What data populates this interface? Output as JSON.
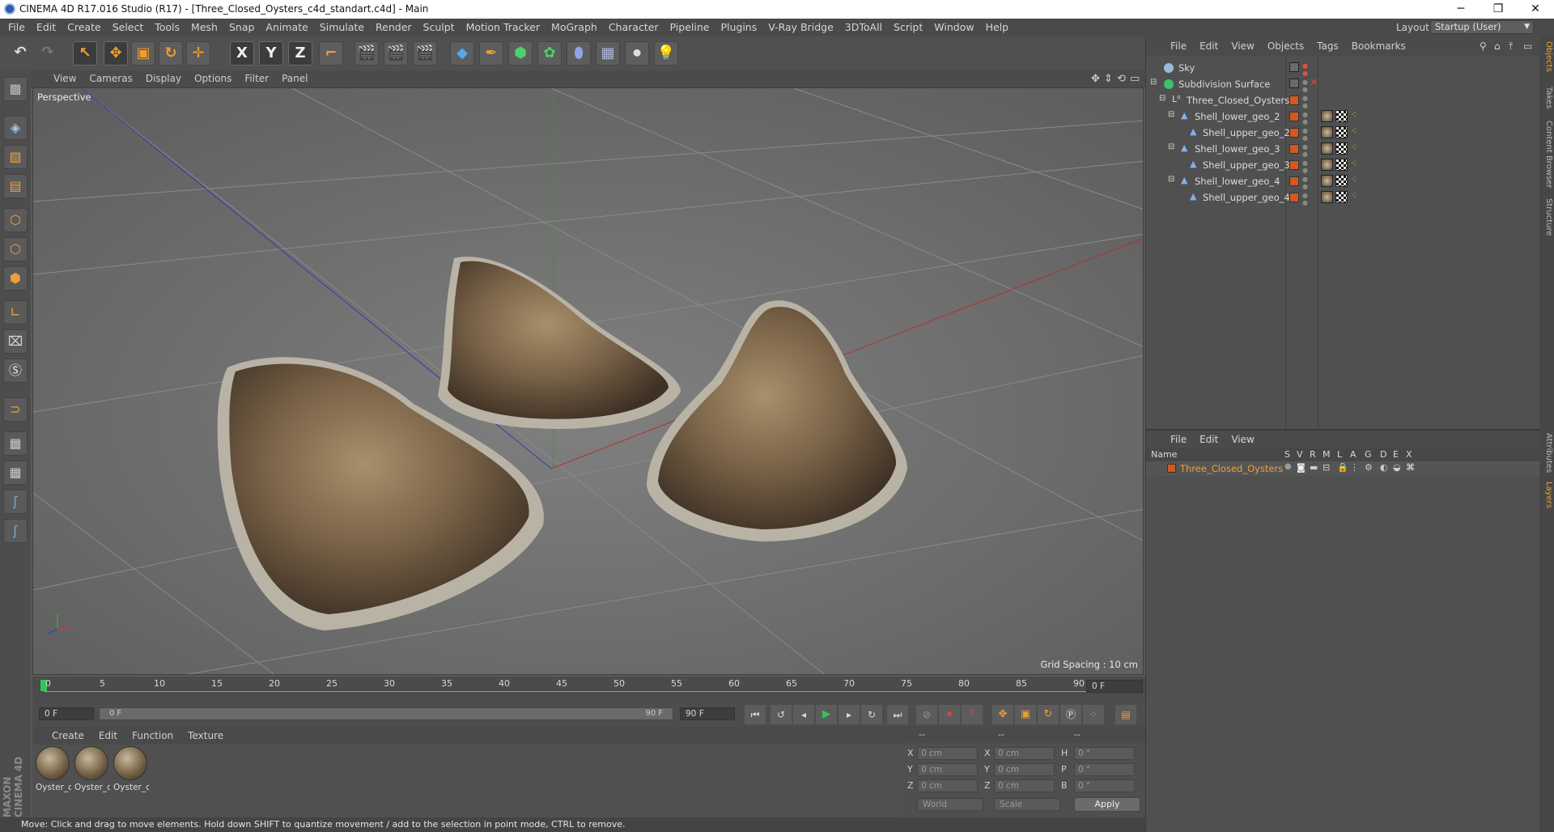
{
  "window": {
    "title": "CINEMA 4D R17.016 Studio (R17) - [Three_Closed_Oysters_c4d_standart.c4d] - Main",
    "minimize": "─",
    "maximize": "❐",
    "close": "✕"
  },
  "menu": [
    "File",
    "Edit",
    "Create",
    "Select",
    "Tools",
    "Mesh",
    "Snap",
    "Animate",
    "Simulate",
    "Render",
    "Sculpt",
    "Motion Tracker",
    "MoGraph",
    "Character",
    "Pipeline",
    "Plugins",
    "V-Ray Bridge",
    "3DToAll",
    "Script",
    "Window",
    "Help"
  ],
  "layout": {
    "label": "Layout:",
    "value": "Startup (User)"
  },
  "toolbar": {
    "x_label": "X",
    "y_label": "Y",
    "z_label": "Z"
  },
  "viewport": {
    "menu": [
      "View",
      "Cameras",
      "Display",
      "Options",
      "Filter",
      "Panel"
    ],
    "camera_label": "Perspective",
    "grid_spacing": "Grid Spacing : 10 cm"
  },
  "timeline": {
    "ticks": [
      "0",
      "5",
      "10",
      "15",
      "20",
      "25",
      "30",
      "35",
      "40",
      "45",
      "50",
      "55",
      "60",
      "65",
      "70",
      "75",
      "80",
      "85",
      "90"
    ],
    "current_frame": "0 F",
    "start_frame": "0 F",
    "range_start": "0 F",
    "range_end": "90 F",
    "end_frame": "90 F"
  },
  "materials": {
    "menu": [
      "Create",
      "Edit",
      "Function",
      "Texture"
    ],
    "items": [
      "Oyster_c",
      "Oyster_c",
      "Oyster_c"
    ]
  },
  "coordinates": {
    "header": [
      "--",
      "--",
      "--"
    ],
    "rows": [
      {
        "a": "X",
        "av": "0 cm",
        "b": "X",
        "bv": "0 cm",
        "c": "H",
        "cv": "0 °"
      },
      {
        "a": "Y",
        "av": "0 cm",
        "b": "Y",
        "bv": "0 cm",
        "c": "P",
        "cv": "0 °"
      },
      {
        "a": "Z",
        "av": "0 cm",
        "b": "Z",
        "bv": "0 cm",
        "c": "B",
        "cv": "0 °"
      }
    ],
    "space": "World",
    "mode": "Scale",
    "apply": "Apply"
  },
  "status": "Move: Click and drag to move elements. Hold down SHIFT to quantize movement / add to the selection in point mode, CTRL to remove.",
  "brand": "MAXON CINEMA 4D",
  "objects": {
    "menu": [
      "File",
      "Edit",
      "View",
      "Objects",
      "Tags",
      "Bookmarks"
    ],
    "tree": [
      {
        "name": "Sky",
        "indent": 0
      },
      {
        "name": "Subdivision Surface",
        "indent": 0
      },
      {
        "name": "Three_Closed_Oysters",
        "indent": 1
      },
      {
        "name": "Shell_lower_geo_2",
        "indent": 2
      },
      {
        "name": "Shell_upper_geo_2",
        "indent": 3
      },
      {
        "name": "Shell_lower_geo_3",
        "indent": 2
      },
      {
        "name": "Shell_upper_geo_3",
        "indent": 3
      },
      {
        "name": "Shell_lower_geo_4",
        "indent": 2
      },
      {
        "name": "Shell_upper_geo_4",
        "indent": 3
      }
    ]
  },
  "layers": {
    "menu": [
      "File",
      "Edit",
      "View"
    ],
    "columns": [
      "Name",
      "S",
      "V",
      "R",
      "M",
      "L",
      "A",
      "G",
      "D",
      "E",
      "X"
    ],
    "rows": [
      {
        "name": "Three_Closed_Oysters"
      }
    ]
  },
  "side_tabs": [
    "Objects",
    "Takes",
    "Content Browser",
    "Structure",
    "Attributes",
    "Layers"
  ],
  "colors": {
    "accent": "#f0a030",
    "layer_name": "#f0a030",
    "object_marker": "#d05a20"
  }
}
